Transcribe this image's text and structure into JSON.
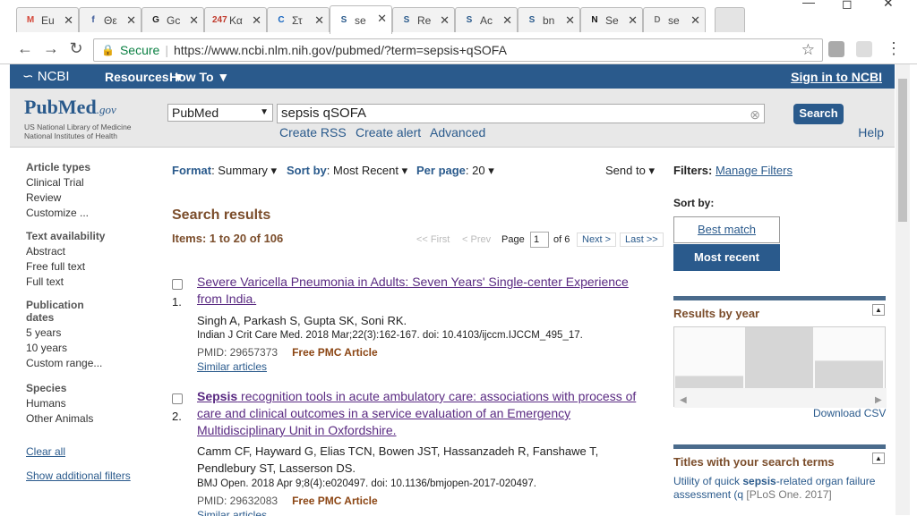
{
  "tabs": [
    {
      "fav": "M",
      "favcolor": "#d44638",
      "label": "Eu"
    },
    {
      "fav": "f",
      "favcolor": "#3b5998",
      "label": "Θε"
    },
    {
      "fav": "G",
      "favcolor": "#222",
      "label": "Gc"
    },
    {
      "fav": "247",
      "favcolor": "#c0392b",
      "label": "Κα"
    },
    {
      "fav": "C",
      "favcolor": "#1565c0",
      "label": "Στ"
    },
    {
      "fav": "S",
      "favcolor": "#2a5a8c",
      "label": "se"
    },
    {
      "fav": "S",
      "favcolor": "#2a5a8c",
      "label": "Re"
    },
    {
      "fav": "S",
      "favcolor": "#2a5a8c",
      "label": "Ac"
    },
    {
      "fav": "S",
      "favcolor": "#2a5a8c",
      "label": "bn"
    },
    {
      "fav": "N",
      "favcolor": "#111",
      "label": "Se"
    },
    {
      "fav": "D",
      "favcolor": "#777",
      "label": "se"
    }
  ],
  "address": {
    "secure": "Secure",
    "url": "https://www.ncbi.nlm.nih.gov/pubmed/?term=sepsis+qSOFA"
  },
  "ncbi": {
    "logo": "NCBI",
    "resources": "Resources",
    "howto": "How To",
    "signin": "Sign in to NCBI"
  },
  "header": {
    "logo_pub": "Pub",
    "logo_med": "Med",
    "logo_gov": ".gov",
    "sub1": "US National Library of Medicine",
    "sub2": "National Institutes of Health",
    "db": "PubMed",
    "query": "sepsis qSOFA",
    "search": "Search",
    "rss": "Create RSS",
    "alert": "Create alert",
    "advanced": "Advanced",
    "help": "Help"
  },
  "left": {
    "article_types": "Article types",
    "at": [
      "Clinical Trial",
      "Review",
      "Customize ..."
    ],
    "text_avail": "Text availability",
    "ta": [
      "Abstract",
      "Free full text",
      "Full text"
    ],
    "pub_dates_1": "Publication",
    "pub_dates_2": "dates",
    "pd": [
      "5 years",
      "10 years",
      "Custom range..."
    ],
    "species": "Species",
    "sp": [
      "Humans",
      "Other Animals"
    ],
    "clear": "Clear all",
    "show": "Show additional filters"
  },
  "toolbar": {
    "format_l": "Format",
    "format_v": "Summary",
    "sort_l": "Sort by",
    "sort_v": "Most Recent",
    "per_l": "Per page",
    "per_v": "20",
    "send": "Send to"
  },
  "results": {
    "heading": "Search results",
    "items": "Items: 1 to 20 of 106",
    "first": "<< First",
    "prev": "< Prev",
    "page_l": "Page",
    "page_v": "1",
    "of": "of 6",
    "next": "Next >",
    "last": "Last >>",
    "list": [
      {
        "num": "1.",
        "title": "Severe Varicella Pneumonia in Adults: Seven Years' Single-center Experience from India.",
        "authors": "Singh A, Parkash S, Gupta SK, Soni RK.",
        "journal": "Indian J Crit Care Med. 2018 Mar;22(3):162-167. doi: 10.4103/ijccm.IJCCM_495_17.",
        "pmid": "PMID: 29657373",
        "free": "Free PMC Article",
        "similar": "Similar articles"
      },
      {
        "num": "2.",
        "title_bold": "Sepsis",
        "title": " recognition tools in acute ambulatory care: associations with process of care and clinical outcomes in a service evaluation of an Emergency Multidisciplinary Unit in Oxfordshire.",
        "authors": "Camm CF, Hayward G, Elias TCN, Bowen JST, Hassanzadeh R, Fanshawe T, Pendlebury ST, Lasserson DS.",
        "journal": "BMJ Open. 2018 Apr 9;8(4):e020497. doi: 10.1136/bmjopen-2017-020497.",
        "pmid": "PMID: 29632083",
        "free": "Free PMC Article",
        "similar": "Similar articles"
      }
    ]
  },
  "right": {
    "filters": "Filters:",
    "manage": "Manage Filters",
    "sortby": "Sort by:",
    "best": "Best match",
    "recent": "Most recent",
    "ryear": "Results by year",
    "csv": "Download CSV",
    "titles": "Titles with your search terms",
    "t1a": "Utility of quick ",
    "t1b": "sepsis",
    "t1c": "-related organ failure assessment (q",
    "t1d": " [PLoS One. 2017]"
  },
  "chart_data": {
    "type": "bar",
    "title": "Results by year",
    "values": [
      0.2,
      1.0,
      0.45
    ]
  }
}
